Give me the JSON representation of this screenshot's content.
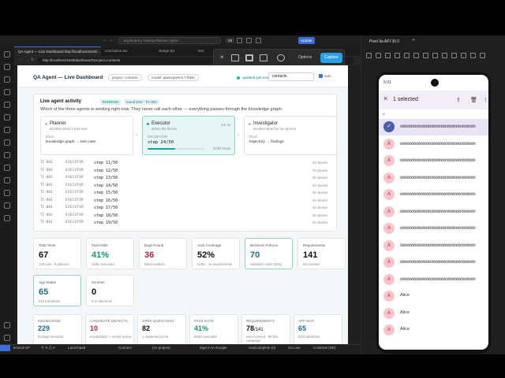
{
  "vscode": {
    "title_command": "Exploratory-Testing-Planner-Agent",
    "badge": "19",
    "update_label": "Update",
    "tabs": [
      "QA Agent — Live Dashboard http://localhost:9100/...",
      "conclusion.tex",
      "design.tex",
      "tem"
    ],
    "url": "http://localhost:9100/dashboard?project=contacts",
    "capture": {
      "options_label": "Options",
      "capture_label": "Capture"
    },
    "statusbar": {
      "branch": "kmacd-v2*",
      "counts": "⓪ 0 ⚠ 0",
      "launchpad": "Launchpad",
      "connect": "Connect",
      "project": "{no project}",
      "signin": "Sign in to Google",
      "autocomplete": "Autocomplete (0)",
      "golive": "Go Live",
      "continue": "Continue (NE)"
    }
  },
  "dashboard": {
    "title": "QA Agent — Live Dashboard",
    "project_pill": "project: contacts",
    "model_pill": "model: qwen/qwen3.7-flash",
    "updated": "updated just now",
    "search_value": "contacts",
    "auto_label": "auto",
    "activity": {
      "heading": "Live agent activity",
      "running": "RUNNING",
      "round": "round 2/10 · TC-003",
      "description": "Which of the three agents is working right now. They never call each other — everything passes through the knowledge graph.",
      "agents": [
        {
          "name": "Planner",
          "desc": "decides what to test next",
          "state": "IDLE",
          "value": "knowledge graph → test case",
          "time": ""
        },
        {
          "name": "Executor",
          "desc": "drives the device",
          "state": "ON DEVICE",
          "value": "step 24/50",
          "time": "4m 4s",
          "steps": "24/50 steps",
          "progress": 0.48
        },
        {
          "name": "Investigator",
          "desc": "decides what the run proved",
          "state": "IDLE",
          "value": "trajectory → findings",
          "time": ""
        }
      ],
      "log": [
        {
          "tc": "TC-003",
          "agent": "EXECUTOR",
          "step": "step 11/50",
          "where": "On device"
        },
        {
          "tc": "TC-003",
          "agent": "EXECUTOR",
          "step": "step 12/50",
          "where": "On device"
        },
        {
          "tc": "TC-003",
          "agent": "EXECUTOR",
          "step": "step 13/50",
          "where": "On device"
        },
        {
          "tc": "TC-003",
          "agent": "EXECUTOR",
          "step": "step 14/50",
          "where": "On device"
        },
        {
          "tc": "TC-003",
          "agent": "EXECUTOR",
          "step": "step 15/50",
          "where": "On device"
        },
        {
          "tc": "TC-003",
          "agent": "EXECUTOR",
          "step": "step 16/50",
          "where": "On device"
        },
        {
          "tc": "TC-003",
          "agent": "EXECUTOR",
          "step": "step 17/50",
          "where": "On device"
        },
        {
          "tc": "TC-003",
          "agent": "EXECUTOR",
          "step": "step 18/50",
          "where": "On device"
        },
        {
          "tc": "TC-003",
          "agent": "EXECUTOR",
          "step": "step 19/50",
          "where": "On device"
        }
      ]
    },
    "stats": [
      {
        "label": "Total Tests",
        "value": "67",
        "sub": "133 runs · 6 planned",
        "color": "#111111"
      },
      {
        "label": "Pass Rate",
        "value": "41%",
        "sub": "25/61 executed",
        "color": "#15966f"
      },
      {
        "label": "Bugs Found",
        "value": "36",
        "sub": "failed verdicts",
        "color": "#b4234a"
      },
      {
        "label": "Area Coverage",
        "value": "52%",
        "sub": "42/81 · vs requirements",
        "color": "#111111"
      },
      {
        "label": "Business Policies",
        "value": "70",
        "sub": "validation rules (SRS)",
        "color": "#1b6f86"
      },
      {
        "label": "Requirements",
        "value": "141",
        "sub": "65 covered",
        "color": "#111111"
      }
    ],
    "stats2": [
      {
        "label": "App States",
        "value": "65",
        "sub": "615 transitions",
        "color": "#1b6f86"
      },
      {
        "label": "Screens",
        "value": "0",
        "sub": "0 UI elements",
        "color": "#111111"
      }
    ],
    "kpis": [
      {
        "label": "KNOWLEDGE",
        "value": "229",
        "sub": "findings recorded",
        "color": "#1b6f86"
      },
      {
        "label": "CANDIDATE DEFECTS",
        "value": "10",
        "sub": "unvalidated — needs review",
        "color": "#b4234a"
      },
      {
        "label": "OPEN QUESTIONS",
        "value": "82",
        "sub": "1 answered so far",
        "color": "#111111"
      },
      {
        "label": "PASS RATE",
        "value": "41%",
        "sub": "25/61 executed",
        "color": "#15966f"
      },
      {
        "label": "REQUIREMENTS",
        "value": "78",
        "value_suffix": "/141",
        "sub": "ever covered · 98 this campaign",
        "color": "#111111"
      },
      {
        "label": "APP MAP",
        "value": "65",
        "sub": "615 transitions",
        "color": "#1b6f86"
      }
    ]
  },
  "emulator": {
    "title": "Pixel 9a API 36.0",
    "time": "5:01",
    "appbar_title": "1 selected",
    "section_letter": "A",
    "rows": [
      {
        "avatar": "✓",
        "text": "öööööööööööööööööööööööööööööööööööööööö",
        "selected": true
      },
      {
        "avatar": "A",
        "text": "öööööööööööööööööööööööööööööööööööööööö",
        "selected": false
      },
      {
        "avatar": "A",
        "text": "öööööööööööööööööööööööööööööööööööööööö",
        "selected": false
      },
      {
        "avatar": "A",
        "text": "öööööööööööööööööööööööööööööööööööööööö",
        "selected": false
      },
      {
        "avatar": "A",
        "text": "öööööööööööööööööööööööööööööööööööööööö",
        "selected": false
      },
      {
        "avatar": "A",
        "text": "öööööööööööööööööööööööööööööööööööööööö",
        "selected": false
      },
      {
        "avatar": "A",
        "text": "öööööööööööööööööööööööööööööööööööööööö",
        "selected": false
      },
      {
        "avatar": "A",
        "text": "öööööööööööööööööööööööööööööööööööööööö",
        "selected": false
      },
      {
        "avatar": "A",
        "text": "öööööööööööööööööööööööööööööööööööööööö",
        "selected": false
      },
      {
        "avatar": "A",
        "text": "öööööööööööööööööööööööööööööööööööööööö",
        "selected": false
      },
      {
        "avatar": "A",
        "text": "Alice",
        "selected": false
      },
      {
        "avatar": "A",
        "text": "Alice",
        "selected": false
      },
      {
        "avatar": "A",
        "text": "Alice",
        "selected": false
      }
    ]
  }
}
